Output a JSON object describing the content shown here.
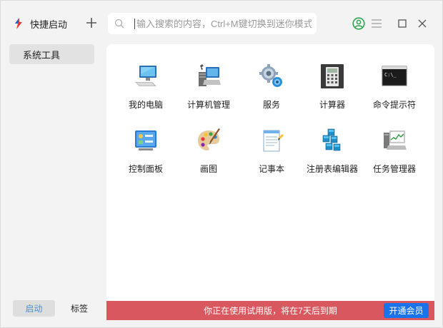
{
  "app": {
    "name": "快捷启动"
  },
  "search": {
    "placeholder": "输入搜索的内容，Ctrl+M键切换到迷你模式"
  },
  "sidebar": {
    "items": [
      {
        "label": "系统工具"
      }
    ]
  },
  "tools": [
    {
      "label": "我的电脑",
      "icon": "computer-icon"
    },
    {
      "label": "计算机管理",
      "icon": "computer-management-icon"
    },
    {
      "label": "服务",
      "icon": "services-gears-icon"
    },
    {
      "label": "计算器",
      "icon": "calculator-icon"
    },
    {
      "label": "命令提示符",
      "icon": "command-prompt-icon"
    },
    {
      "label": "控制面板",
      "icon": "control-panel-icon"
    },
    {
      "label": "画图",
      "icon": "paint-palette-icon"
    },
    {
      "label": "记事本",
      "icon": "notepad-icon"
    },
    {
      "label": "注册表编辑器",
      "icon": "registry-editor-icon"
    },
    {
      "label": "任务管理器",
      "icon": "task-manager-icon"
    }
  ],
  "bottom_tabs": {
    "launch": "启动",
    "tags": "标签"
  },
  "banner": {
    "text": "你正在使用试用版，将在7天后到期",
    "button": "开通会员"
  },
  "colors": {
    "accent": "#1a73e8",
    "banner": "#d9575e",
    "active_tab_text": "#4a8fd8",
    "user_icon": "#2ea44f"
  }
}
